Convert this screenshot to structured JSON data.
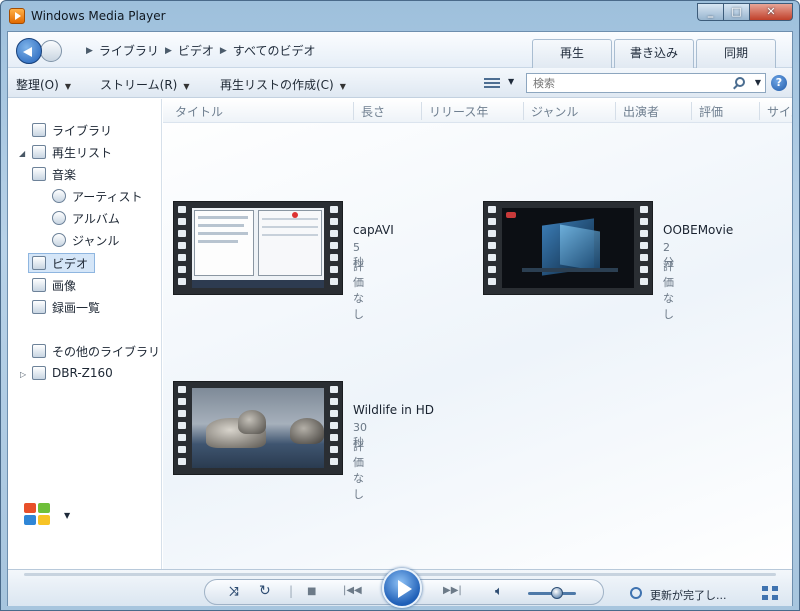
{
  "window": {
    "title": "Windows Media Player"
  },
  "nav": {
    "breadcrumb": [
      "ライブラリ",
      "ビデオ",
      "すべてのビデオ"
    ],
    "tabs": [
      "再生",
      "書き込み",
      "同期"
    ]
  },
  "toolbar": {
    "organize": "整理(O)",
    "stream": "ストリーム(R)",
    "create_playlist": "再生リストの作成(C)",
    "search_placeholder": "検索"
  },
  "sidebar": {
    "library": "ライブラリ",
    "playlists": "再生リスト",
    "music": "音楽",
    "artist": "アーティスト",
    "album": "アルバム",
    "genre": "ジャンル",
    "video": "ビデオ",
    "pictures": "画像",
    "recorded_tv": "録画一覧",
    "other_libraries": "その他のライブラリ",
    "device": "DBR-Z160"
  },
  "columns": [
    "タイトル",
    "長さ",
    "リリース年",
    "ジャンル",
    "出演者",
    "評価",
    "サイズ"
  ],
  "videos": [
    {
      "title": "capAVI",
      "duration": "5 秒",
      "rating": "評価なし"
    },
    {
      "title": "OOBEMovie",
      "duration": "2 分",
      "rating": "評価なし"
    },
    {
      "title": "Wildlife in HD",
      "duration": "30 秒",
      "rating": "評価なし"
    }
  ],
  "player": {
    "status": "更新が完了し...",
    "volume": 0.6
  },
  "colors": {
    "accent": "#1f5fb7",
    "selection": "#d5e6f8"
  }
}
